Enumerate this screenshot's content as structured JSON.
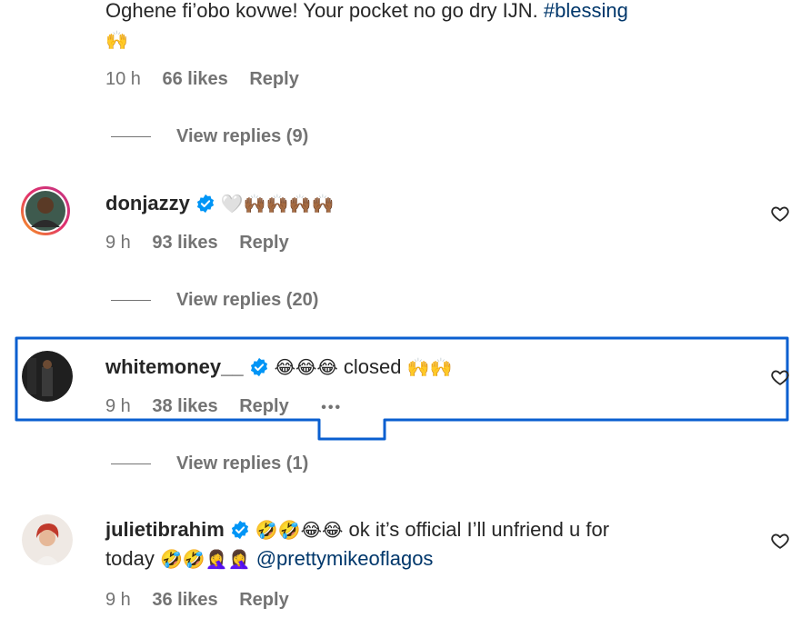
{
  "comments": [
    {
      "text": "Oghene fi’obo kovwe! Your pocket no go dry IJN.",
      "hashtag": "#blessing",
      "emoji_line": "🙌",
      "time": "10 h",
      "likes": "66 likes",
      "reply": "Reply",
      "view_replies": "View replies (9)"
    },
    {
      "username": "donjazzy",
      "emojis": "🤍🙌🏾🙌🏾🙌🏾🙌🏾",
      "time": "9 h",
      "likes": "93 likes",
      "reply": "Reply",
      "view_replies": "View replies (20)"
    },
    {
      "username": "whitemoney__",
      "emojis": "😂😂😂",
      "text": "closed",
      "emojis_after": "🙌🙌",
      "time": "9 h",
      "likes": "38 likes",
      "reply": "Reply",
      "more": "•••",
      "view_replies": "View replies (1)"
    },
    {
      "username": "julietibrahim",
      "emojis": "🤣🤣😂😂",
      "text": "ok it’s official I’ll unfriend u for",
      "line2_prefix": "today",
      "line2_emojis": "🤣🤣🤦‍♀️🤦‍♀️",
      "mention": "@prettymikeoflagos",
      "time": "9 h",
      "likes": "36 likes",
      "reply": "Reply"
    }
  ],
  "colors": {
    "focus": "#0a5fd0",
    "verified": "#0095f6",
    "link": "#00376b",
    "muted": "#737373"
  },
  "icons": {
    "verified": "verified-badge-icon",
    "heart": "heart-outline-icon",
    "more": "more-dots-icon"
  }
}
